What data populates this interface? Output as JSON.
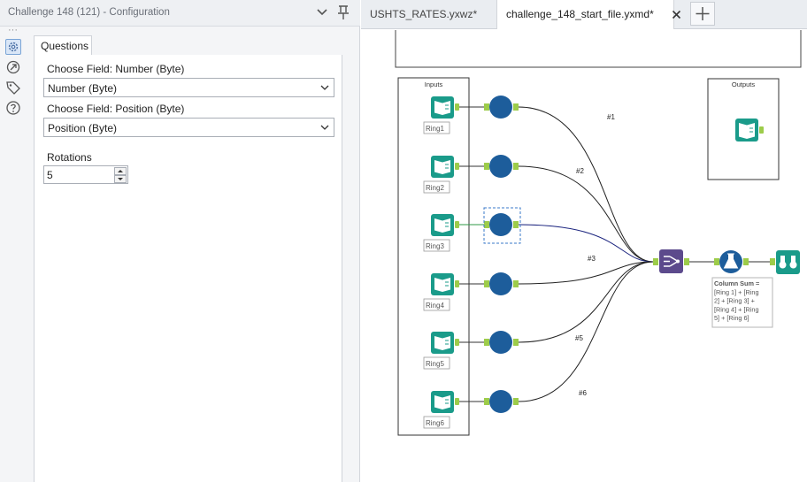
{
  "config": {
    "title": "Challenge 148 (121) - Configuration",
    "dots": "···",
    "side_icons": [
      "gear-icon",
      "navigate-icon",
      "tag-icon",
      "help-icon"
    ],
    "tab_label": "Questions",
    "field1_label": "Choose Field: Number (Byte)",
    "field1_value": "Number (Byte)",
    "field2_label": "Choose Field: Position (Byte)",
    "field2_value": "Position (Byte)",
    "rotations_label": "Rotations",
    "rotations_value": "5"
  },
  "tabs": [
    {
      "label": "USHTS_RATES.yxwz*"
    },
    {
      "label": "challenge_148_start_file.yxmd*"
    }
  ],
  "add_tab_icon": "plus-icon",
  "canvas": {
    "inputs_container_label": "Inputs",
    "outputs_container_label": "Outputs",
    "ring_labels": [
      "Ring1",
      "Ring2",
      "Ring3",
      "Ring4",
      "Ring5",
      "Ring6"
    ],
    "connection_labels": [
      "#1",
      "#2",
      "#3",
      "#5",
      "#6"
    ],
    "formula_annotation": [
      "Column Sum =",
      "[Ring 1] + [Ring",
      "2] + [Ring 3] +",
      "[Ring 4] + [Ring",
      "5] + [Ring 6]"
    ],
    "colors": {
      "input_tool": "#1a9b8a",
      "macro_tool": "#1d5d9b",
      "union_tool": "#5c4a8c",
      "formula_tool": "#1d5d9b",
      "browse_tool": "#1a9b8a",
      "anchor": "#9dcc4a"
    }
  }
}
